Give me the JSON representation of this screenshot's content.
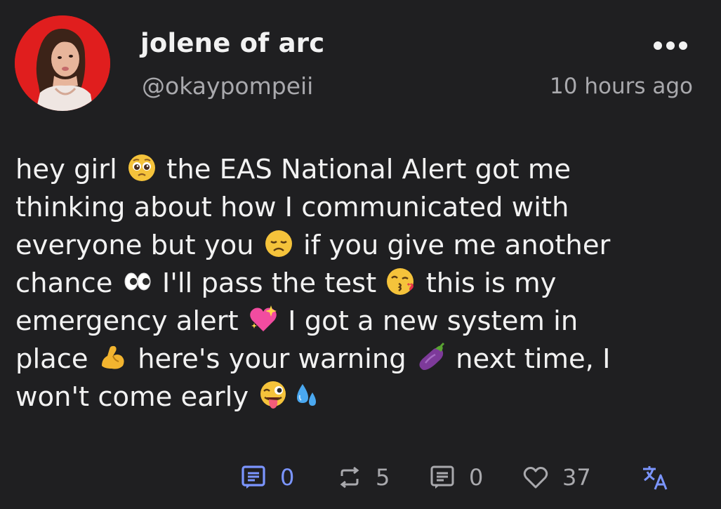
{
  "author": {
    "display_name": "jolene of arc",
    "handle": "@okaypompeii"
  },
  "post": {
    "timestamp": "10 hours ago",
    "text_lines": [
      [
        "hey girl ",
        "pleading-face-emoji",
        " the EAS National Alert got me"
      ],
      [
        "thinking about how I communicated with"
      ],
      [
        "everyone but you ",
        "disappointed-face-emoji",
        " if you give me another"
      ],
      [
        "chance ",
        "eyes-emoji",
        " I'll pass the test ",
        "kissing-face-emoji",
        " this is my"
      ],
      [
        "emergency alert ",
        "sparkling-heart-emoji",
        " I got a new system in"
      ],
      [
        "place ",
        "flexed-biceps-emoji",
        " here's your warning ",
        "eggplant-emoji",
        " next time, I"
      ],
      [
        "won't come early ",
        "winking-tongue-emoji",
        "sweat-droplets-emoji"
      ]
    ]
  },
  "actions": {
    "quote_count": "0",
    "boost_count": "5",
    "reply_count": "0",
    "like_count": "37"
  },
  "icons": {
    "more": "more-horizontal-icon",
    "quote": "quote-icon",
    "boost": "boost-icon",
    "reply": "reply-icon",
    "like": "heart-icon",
    "translate": "translate-icon"
  },
  "colors": {
    "background": "#1f1f21",
    "primary_text": "#f2f2f2",
    "secondary_text": "#a9a9ad",
    "accent": "#6d8cff",
    "avatar_bg": "#e01e1e"
  }
}
